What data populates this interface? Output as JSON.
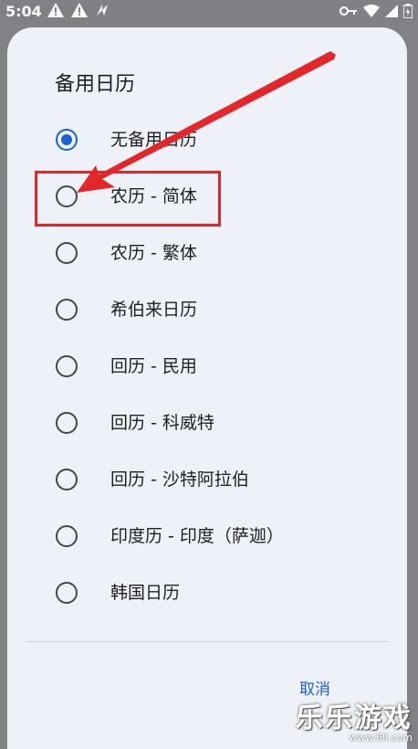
{
  "status_bar": {
    "time": "5:04",
    "left_icons": [
      "warning-icon",
      "warning-icon",
      "signal-icon"
    ],
    "right_icons": [
      "key-icon",
      "wifi-icon",
      "cell-signal-icon",
      "battery-icon"
    ]
  },
  "dialog": {
    "title": "备用日历",
    "options": [
      {
        "label": "无备用日历",
        "checked": true
      },
      {
        "label": "农历 - 简体",
        "checked": false
      },
      {
        "label": "农历 - 繁体",
        "checked": false
      },
      {
        "label": "希伯来日历",
        "checked": false
      },
      {
        "label": "回历 - 民用",
        "checked": false
      },
      {
        "label": "回历 - 科威特",
        "checked": false
      },
      {
        "label": "回历 - 沙特阿拉伯",
        "checked": false
      },
      {
        "label": "印度历 - 印度（萨迦）",
        "checked": false
      },
      {
        "label": "韩国日历",
        "checked": false
      }
    ],
    "cancel_label": "取消"
  },
  "annotation": {
    "color": "#e3262a"
  },
  "watermark": {
    "main": "乐乐游戏",
    "sub": "www.6ll.com"
  },
  "colors": {
    "accent": "#1b62d0",
    "dialog_bg": "#eef1f7"
  }
}
